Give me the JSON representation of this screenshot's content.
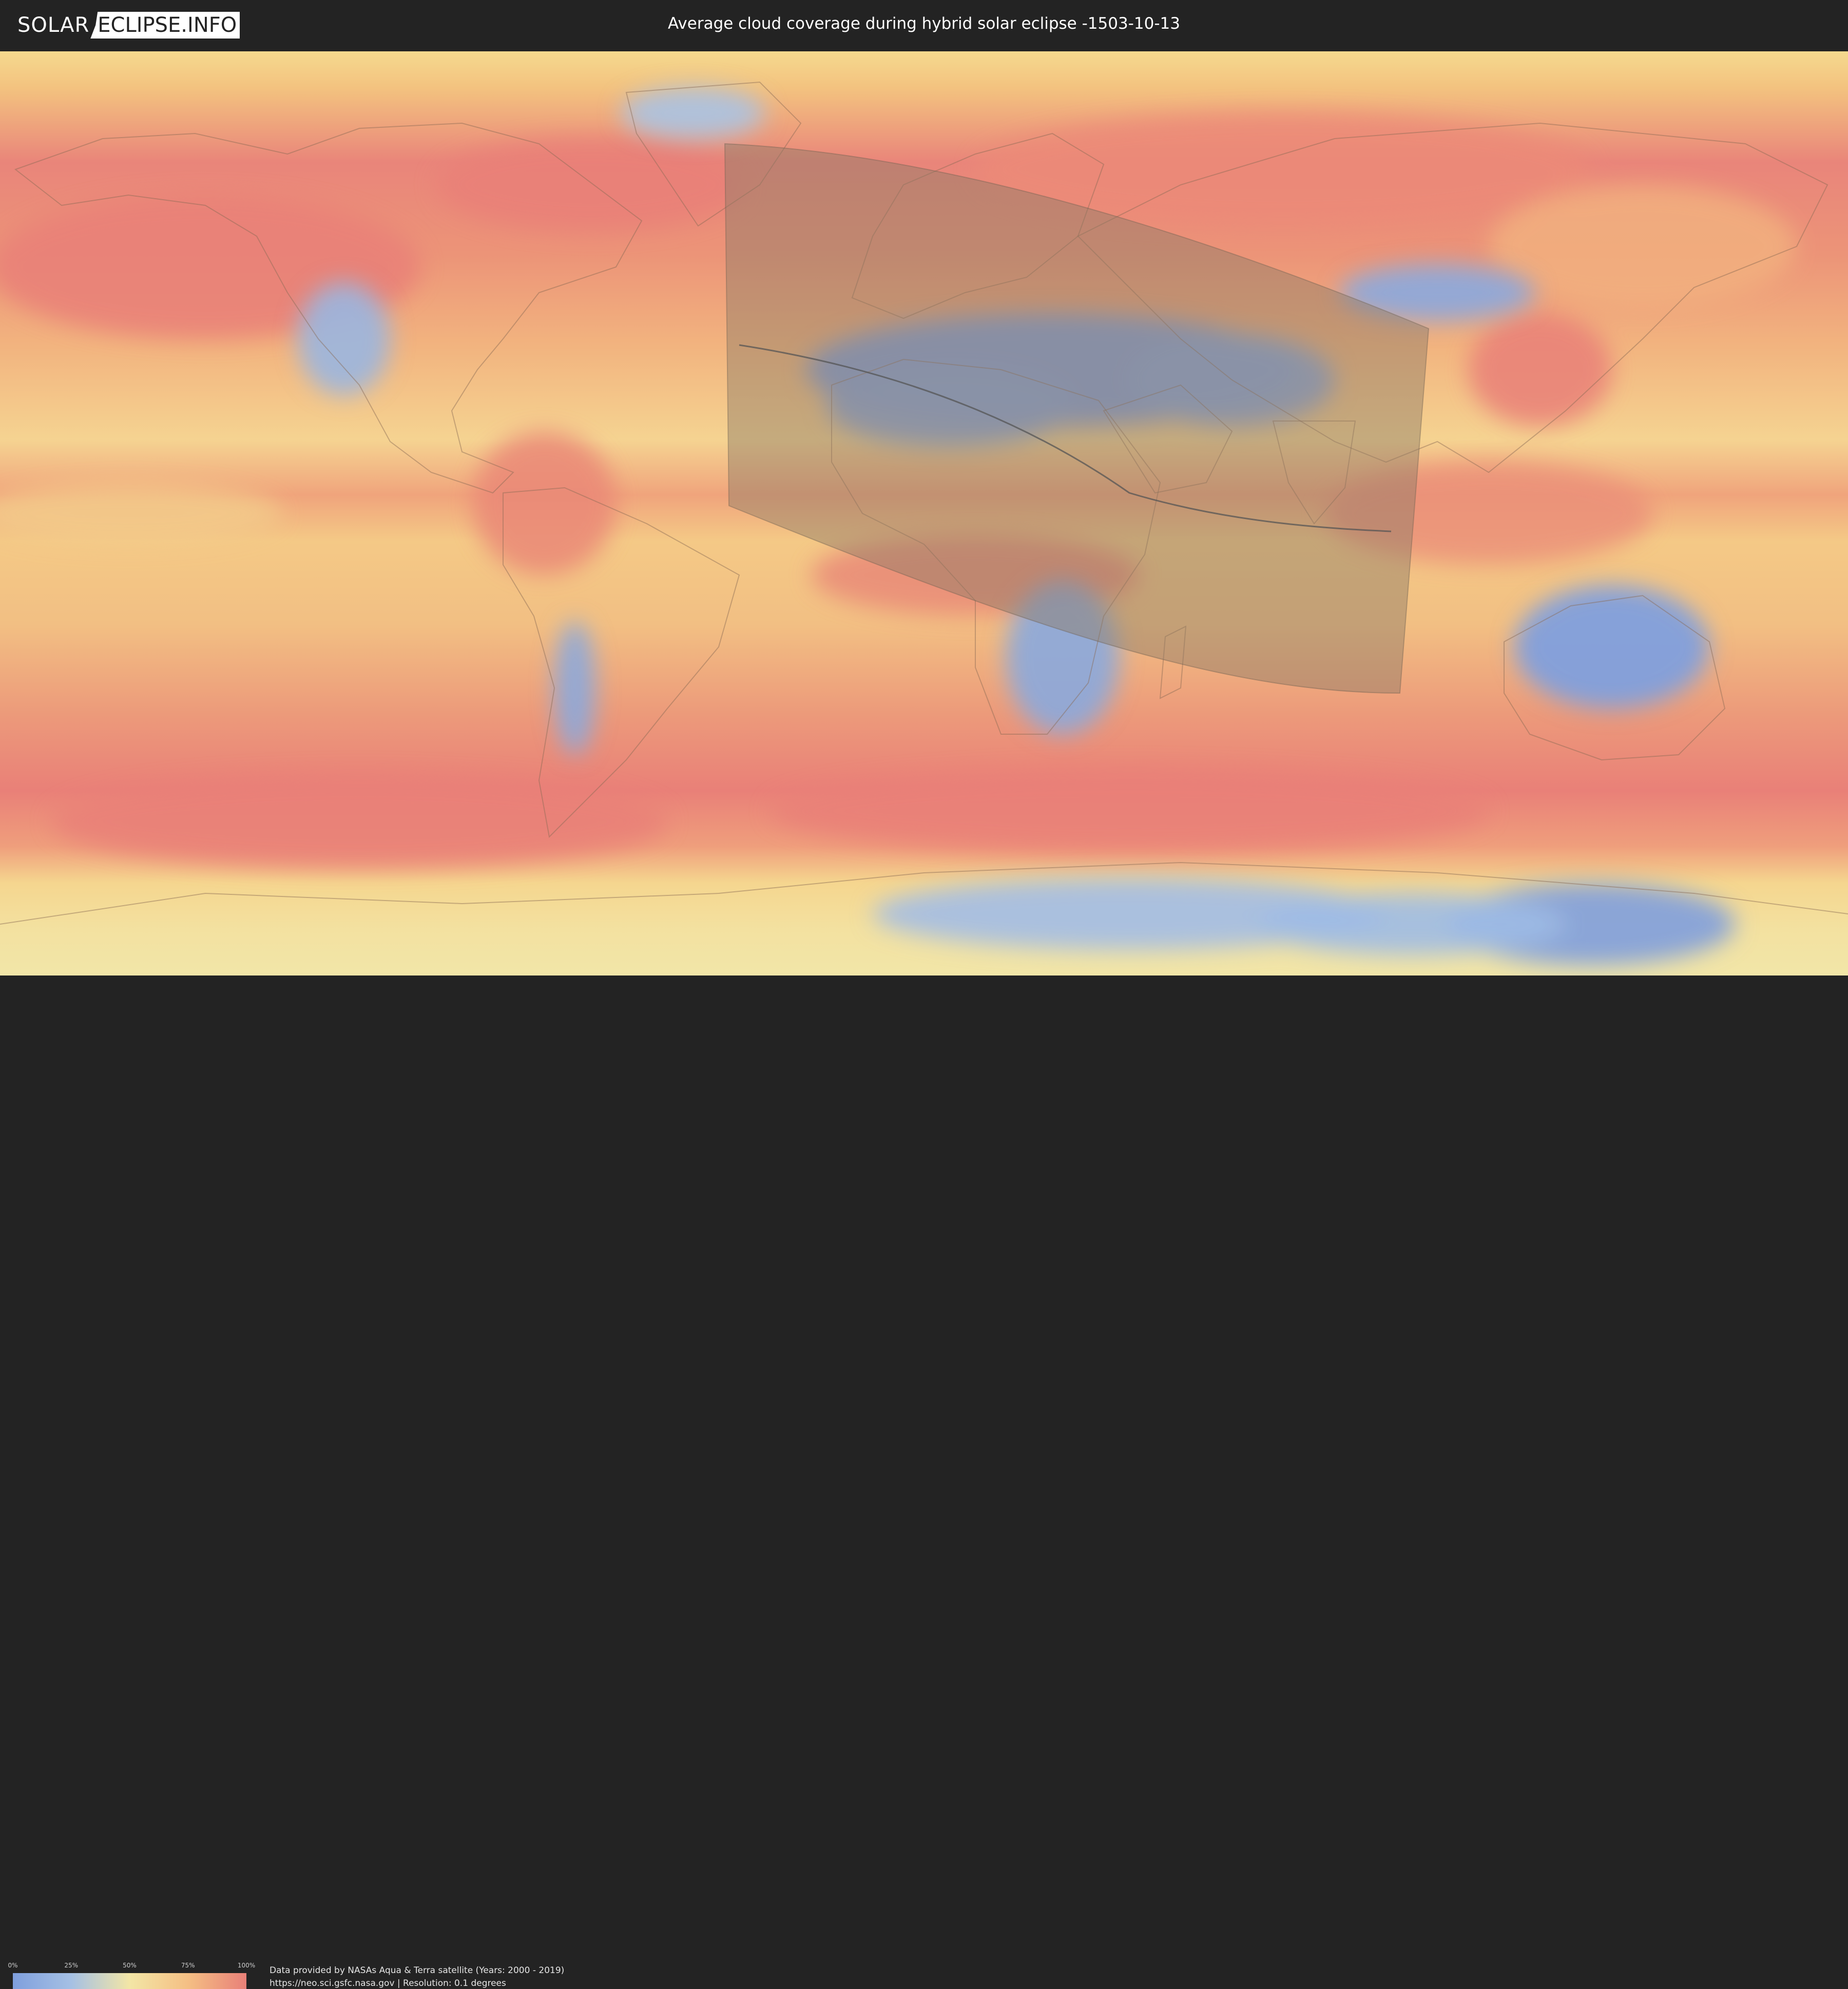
{
  "header": {
    "logo_left": "SOLAR",
    "logo_right": "ECLIPSE.INFO",
    "title": "Average cloud coverage during hybrid solar eclipse -1503-10-13"
  },
  "legend": {
    "ticks": [
      "0%",
      "25%",
      "50%",
      "75%",
      "100%"
    ],
    "tick_values": [
      0,
      25,
      50,
      75,
      100
    ],
    "colors": [
      "#7f9fdd",
      "#a5c0e4",
      "#f3e6a6",
      "#f4bf84",
      "#e98078"
    ]
  },
  "footer": {
    "line1": "Data provided by NASAs Aqua & Terra satellite (Years: 2000 - 2019)",
    "line2": "https://neo.sci.gsfc.nasa.gov | Resolution: 0.1 degrees"
  },
  "map": {
    "projection": "equirectangular",
    "eclipse_region_color": "#8c7b65",
    "central_line_color": "#555555"
  }
}
